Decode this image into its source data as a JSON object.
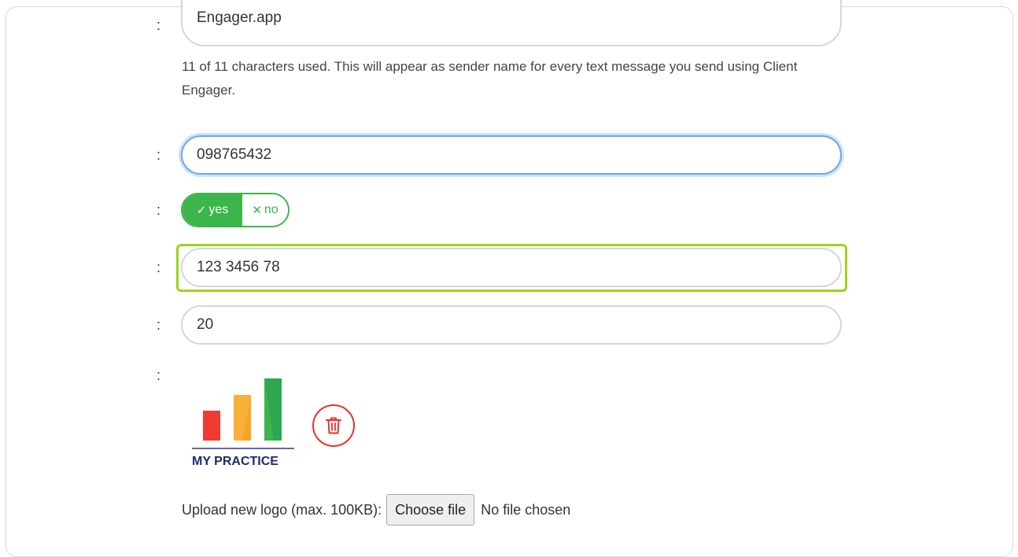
{
  "sender_name": {
    "value": "Engager.app",
    "help": "11 of 11 characters used. This will appear as sender name for every text message you send using Client Engager."
  },
  "phone": {
    "value": "098765432"
  },
  "toggle": {
    "yes_label": "yes",
    "no_label": "no",
    "selected": "yes"
  },
  "number_field": {
    "value": "123 3456 78"
  },
  "count_field": {
    "value": "20"
  },
  "logo": {
    "text": "MY PRACTICE",
    "bar_colors": [
      "#f03a32",
      "#f5a623",
      "#3cb54a"
    ]
  },
  "upload": {
    "label": "Upload new logo (max. 100KB):",
    "button_label": "Choose file",
    "status": "No file chosen"
  },
  "colons": {
    "c1": ":",
    "c2": ":",
    "c3": ":",
    "c4": ":",
    "c5": ":",
    "c6": ":"
  },
  "colors": {
    "toggle_green": "#3cb54a",
    "focus_blue": "#6aa6f0",
    "highlight_green": "#9ad41e",
    "delete_red": "#e8322e"
  }
}
